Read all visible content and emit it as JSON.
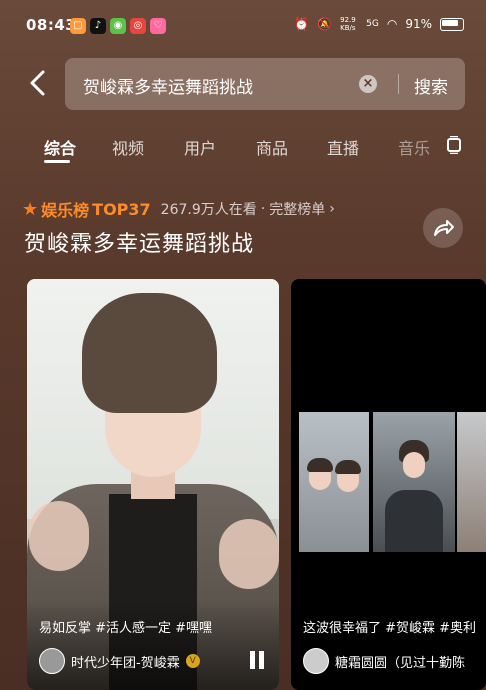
{
  "status_bar": {
    "time": "08:43",
    "network_speed": "92.9 KB/s",
    "signal": "5G",
    "battery": "91%"
  },
  "search": {
    "query": "贺峻霖多幸运舞蹈挑战",
    "button_label": "搜索"
  },
  "tabs": [
    {
      "label": "综合",
      "active": true
    },
    {
      "label": "视频",
      "active": false
    },
    {
      "label": "用户",
      "active": false
    },
    {
      "label": "商品",
      "active": false
    },
    {
      "label": "直播",
      "active": false
    },
    {
      "label": "音乐",
      "active": false
    }
  ],
  "ranking": {
    "board_name": "娱乐榜",
    "rank": "TOP37",
    "viewers": "267.9万人在看",
    "separator": "·",
    "full_list": "完整榜单",
    "title": "贺峻霖多幸运舞蹈挑战"
  },
  "videos": [
    {
      "caption": "易如反掌 #活人感一定 #嘿嘿",
      "author": "时代少年团-贺峻霖",
      "verified": true
    },
    {
      "caption": "这波很幸福了 #贺峻霖 #奥利",
      "author": "糖霜圆圆（见过十勤陈"
    }
  ],
  "colors": {
    "accent_orange": "#ff8a2a",
    "background": "#5a3a2c"
  }
}
